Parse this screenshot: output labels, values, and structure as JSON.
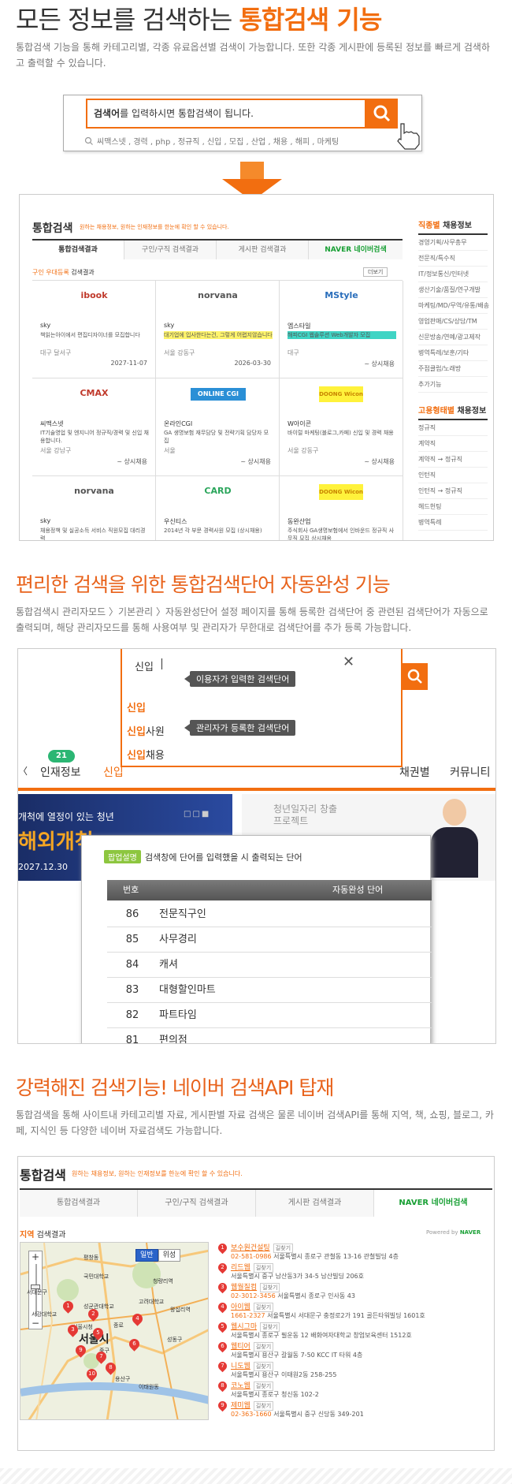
{
  "colors": {
    "accent": "#f26e10",
    "accent_dark": "#e8621b",
    "text": "#333333",
    "muted": "#777777"
  },
  "section1": {
    "title_plain": "모든 정보를 검색하는",
    "title_hl": "통합검색 기능",
    "desc": "통합검색 기능을 통해 카테고리별, 각종 유료옵션별 검색이 가능합니다. 또한 각종 게시판에 등록된 정보를 빠르게 검색하고 출력할 수 있습니다.",
    "search_bold": "검색어",
    "search_rest": "를 입력하시면 통합검색이 됩니다.",
    "keywords": "씨맥스넷 , 경력 , php , 정규직 , 신입 , 모집 , 산업 , 채용 , 해피 , 마케팅"
  },
  "preview1": {
    "title": "통합검색",
    "subtitle": "원하는 채용정보, 원하는 인재정보를 한눈에 확인 할 수 있습니다.",
    "tabs": [
      "통합검색결과",
      "구인/구직 검색결과",
      "게시판 검색결과",
      "NAVER 네이버검색"
    ],
    "section_label_hl": "구인 우대등록",
    "section_label_rest": "검색결과",
    "more": "더보기",
    "cards": [
      {
        "logo": "ibook",
        "company": "sky",
        "text": "책읽는아이에서 편집디자이너를 모집합니다",
        "loc": "대구 달서구",
        "date": "2027-11-07"
      },
      {
        "logo": "norvana",
        "company": "sky",
        "text": "대기업에 입사한다는건, 그렇게 어렵지않습니다",
        "loc": "서울 강동구",
        "date": "2026-03-30"
      },
      {
        "logo": "MStyle",
        "company": "엠스타일",
        "text": "해피CGI 웹솔루션 Web개발자 모집",
        "loc": "대구",
        "date": "~ 상시채용"
      },
      {
        "logo": "CMAX",
        "company": "씨맥스넷",
        "text": "IT기술영업 및 엔지니어 정규직/경력 및 신입 채용합니다.",
        "loc": "서울 강남구",
        "date": "~ 상시채용"
      },
      {
        "logo": "ONLINE CGI",
        "company": "온라인CGI",
        "text": "GA 생명보험 재무담당 및 전략기획 담당자 모집",
        "loc": "서울",
        "date": "~ 상시채용"
      },
      {
        "logo": "DOONG Wicon",
        "company": "W아이콘",
        "text": "바이럴 마케팅(블로그,카페) 신입 및 경력 채용",
        "loc": "서울 강동구",
        "date": "~ 상시채용"
      },
      {
        "logo": "norvana",
        "company": "sky",
        "text": "채용정책 및 실공소득 서비스 직원모집 대리경력",
        "loc": "",
        "date": ""
      },
      {
        "logo": "CARD",
        "company": "우신티스",
        "text": "2014년 각 부문 경력사원 모집 (상시채용)",
        "loc": "",
        "date": ""
      },
      {
        "logo": "DOONG Wicon",
        "company": "동완산업",
        "text": "주식회사 GA생명보험에서 인바운드 정규직 사무직 모집 상시채용",
        "loc": "",
        "date": ""
      }
    ],
    "side1_hl": "직종별",
    "side1_rest": "채용정보",
    "side1_items": [
      "경영기획/사무총무",
      "전문직/특수직",
      "IT/정보통신/인터넷",
      "생산기술/품질/연구개발",
      "마케팅/MD/무역/유통/배송",
      "영업판매/CS/상담/TM",
      "신문방송/연예/광고제작",
      "병역특례/보훈/기타",
      "주점클럽/노래방",
      "추가기능"
    ],
    "side2_hl": "고용형태별",
    "side2_rest": "채용정보",
    "side2_items": [
      "정규직",
      "계약직",
      "계약직 → 정규직",
      "인턴직",
      "인턴직 → 정규직",
      "헤드헌팅",
      "병역특례"
    ]
  },
  "section2": {
    "title": "편리한 검색을 위한 통합검색단어 자동완성 기능",
    "desc": "통합검색시 관리자모드 〉기본관리 〉자동완성단어 설정 페이지를 통해 등록한 검색단어 중 관련된 검색단어가 자동으로 출력되며, 해당 관리자모드를 통해 사용여부 및 관리자가 무한대로 검색단어를 추가 등록 가능합니다.",
    "typed": "신입",
    "user_label": "이용자가 입력한 검색단어",
    "admin_label": "관리자가 등록한 검색단어",
    "suggestions": [
      "신입",
      "신입사원",
      "신입채용"
    ],
    "nav": [
      "인재정보",
      "신입",
      "채권별",
      "커뮤니티"
    ],
    "badge": "21",
    "banner_line1": "개척에 열정이 있는 청년",
    "banner_big": "해외개척",
    "banner_date": "2027.12.30",
    "banner2_line": "청년일자리 창출 프로젝트",
    "help_badge": "팝업설명",
    "help_text": "검색창에 단어를 입력했을 시 출력되는 단어",
    "table_head": [
      "번호",
      "자동완성 단어"
    ],
    "rows": [
      [
        "86",
        "전문직구인"
      ],
      [
        "85",
        "사무경리"
      ],
      [
        "84",
        "캐셔"
      ],
      [
        "83",
        "대형할인마트"
      ],
      [
        "82",
        "파트타임"
      ],
      [
        "81",
        "편의점"
      ]
    ]
  },
  "section3": {
    "title": "강력해진 검색기능! 네이버 검색API 탑재",
    "desc": "통합검색을 통해 사이트내 카테고리별 자료, 게시판별 자료 검색은 물론 네이버 검색API를 통해 지역, 책, 쇼핑, 블로그, 카페, 지식인 등 다양한 네이버 자료검색도 가능합니다.",
    "title2": "통합검색",
    "subtitle2": "원하는 채용정보, 원하는 인재정보를 한눈에 확인 할 수 있습니다.",
    "tabs": [
      "통합검색결과",
      "구인/구직 검색결과",
      "게시판 검색결과",
      "NAVER 네이버검색"
    ],
    "region_hl": "지역",
    "region_rest": "검색결과",
    "powered": "Powered by",
    "naver": "NAVER",
    "map_btn1": "일반",
    "map_btn2": "위성",
    "map_labels": [
      "평창동",
      "국민대학교",
      "성균관대학교",
      "서울시청",
      "고려대학교",
      "청량리역",
      "서강대학교",
      "용산구",
      "성동구",
      "이태원동",
      "왕십리역",
      "서대문구",
      "종로",
      "중구"
    ],
    "directions": "길찾기",
    "results": [
      {
        "name": "보수원건설팅",
        "phone": "02-581-0986",
        "addr": "서울특별시 종로구 관철동 13-16 관철빌딩 4층"
      },
      {
        "name": "리드웹",
        "phone": "",
        "addr": "서울특별시 중구 남산동3가 34-5 남산빌딩 206호"
      },
      {
        "name": "웹월질컴",
        "phone": "02-3012-3456",
        "addr": "서울특별시 종로구 인사동 43"
      },
      {
        "name": "아이웹",
        "phone": "1661-2327",
        "addr": "서울특별시 서대문구 충정로2가 191 골든타워빌딩 1601호"
      },
      {
        "name": "웹시그마",
        "phone": "",
        "addr": "서울특별시 종로구 필운동 12 배화여자대학교 창업보육센터 1512호"
      },
      {
        "name": "웹티어",
        "phone": "",
        "addr": "서울특별시 용산구 갈월동 7-50 KCC IT 타워 4층"
      },
      {
        "name": "니도웹",
        "phone": "",
        "addr": "서울특별시 용산구 이태원2동 258-255"
      },
      {
        "name": "코노웹",
        "phone": "",
        "addr": "서울특별시 종로구 청신동 102-2"
      },
      {
        "name": "제미웹",
        "phone": "02-363-1660",
        "addr": "서울특별시 중구 신당동 349-201"
      }
    ]
  }
}
